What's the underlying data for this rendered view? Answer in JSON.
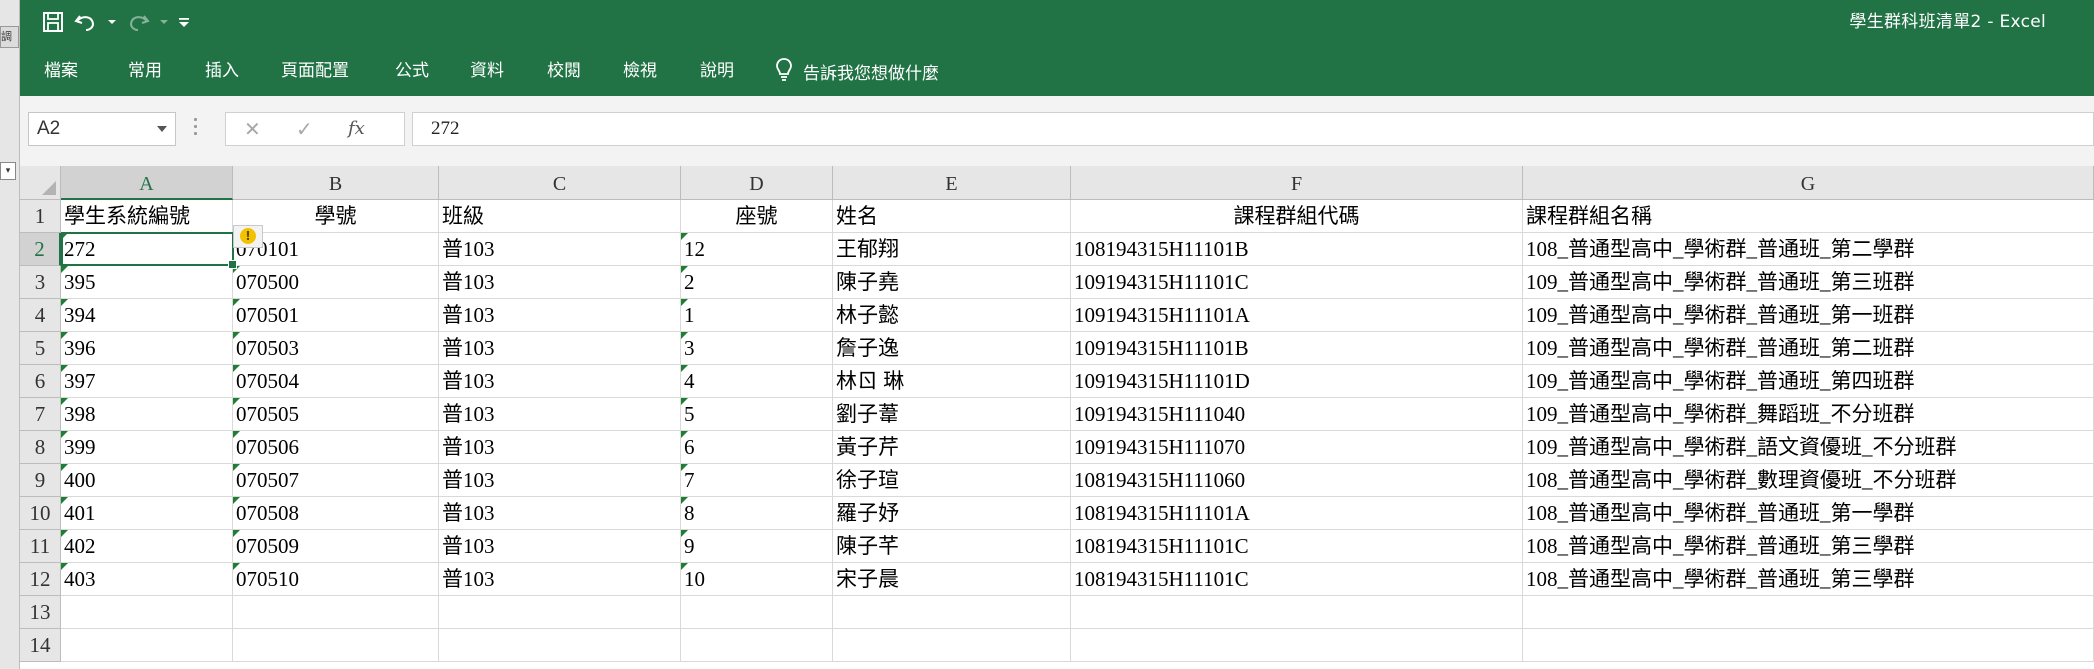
{
  "left_strip": {
    "chip_text": "調",
    "dropdown_glyph": "▾"
  },
  "titlebar": {
    "title": "學生群科班清單2 - Excel"
  },
  "quick_access": {
    "save": "save-icon",
    "undo": "undo-icon",
    "redo": "redo-icon",
    "customize": "customize-icon"
  },
  "ribbon": {
    "tabs": [
      "檔案",
      "常用",
      "插入",
      "頁面配置",
      "公式",
      "資料",
      "校閱",
      "檢視",
      "說明"
    ],
    "tell_me": "告訴我您想做什麼"
  },
  "formula_bar": {
    "name_box": "A2",
    "cancel": "✕",
    "enter": "✓",
    "fx": "fx",
    "formula": "272"
  },
  "sheet": {
    "columns": [
      "A",
      "B",
      "C",
      "D",
      "E",
      "F",
      "G"
    ],
    "row_numbers": [
      "1",
      "2",
      "3",
      "4",
      "5",
      "6",
      "7",
      "8",
      "9",
      "10",
      "11",
      "12",
      "13",
      "14"
    ],
    "headers": [
      "學生系統編號",
      "學號",
      "班級",
      "座號",
      "姓名",
      "課程群組代碼",
      "課程群組名稱"
    ],
    "rows": [
      [
        "272",
        "070101",
        "普103",
        "12",
        "王郁翔",
        "108194315H11101B",
        "108_普通型高中_學術群_普通班_第二學群"
      ],
      [
        "395",
        "070500",
        "普103",
        "2",
        "陳子堯",
        "109194315H11101C",
        "109_普通型高中_學術群_普通班_第三班群"
      ],
      [
        "394",
        "070501",
        "普103",
        "1",
        "林子懿",
        "109194315H11101A",
        "109_普通型高中_學術群_普通班_第一班群"
      ],
      [
        "396",
        "070503",
        "普103",
        "3",
        "詹子逸",
        "109194315H11101B",
        "109_普通型高中_學術群_普通班_第二班群"
      ],
      [
        "397",
        "070504",
        "普103",
        "4",
        "林ㄖ 琳",
        "109194315H11101D",
        "109_普通型高中_學術群_普通班_第四班群"
      ],
      [
        "398",
        "070505",
        "普103",
        "5",
        "劉子葦",
        "109194315H111040",
        "109_普通型高中_學術群_舞蹈班_不分班群"
      ],
      [
        "399",
        "070506",
        "普103",
        "6",
        "黃子芹",
        "109194315H111070",
        "109_普通型高中_學術群_語文資優班_不分班群"
      ],
      [
        "400",
        "070507",
        "普103",
        "7",
        "徐子瑄",
        "108194315H111060",
        "108_普通型高中_學術群_數理資優班_不分班群"
      ],
      [
        "401",
        "070508",
        "普103",
        "8",
        "羅子妤",
        "108194315H11101A",
        "108_普通型高中_學術群_普通班_第一學群"
      ],
      [
        "402",
        "070509",
        "普103",
        "9",
        "陳子芊",
        "108194315H11101C",
        "108_普通型高中_學術群_普通班_第三學群"
      ],
      [
        "403",
        "070510",
        "普103",
        "10",
        "宋子晨",
        "108194315H11101C",
        "108_普通型高中_學術群_普通班_第三學群"
      ]
    ],
    "active_cell": "A2"
  },
  "colors": {
    "excel_green": "#217346",
    "error_triangle": "#1e7e34",
    "warning_yellow": "#f2c200"
  }
}
